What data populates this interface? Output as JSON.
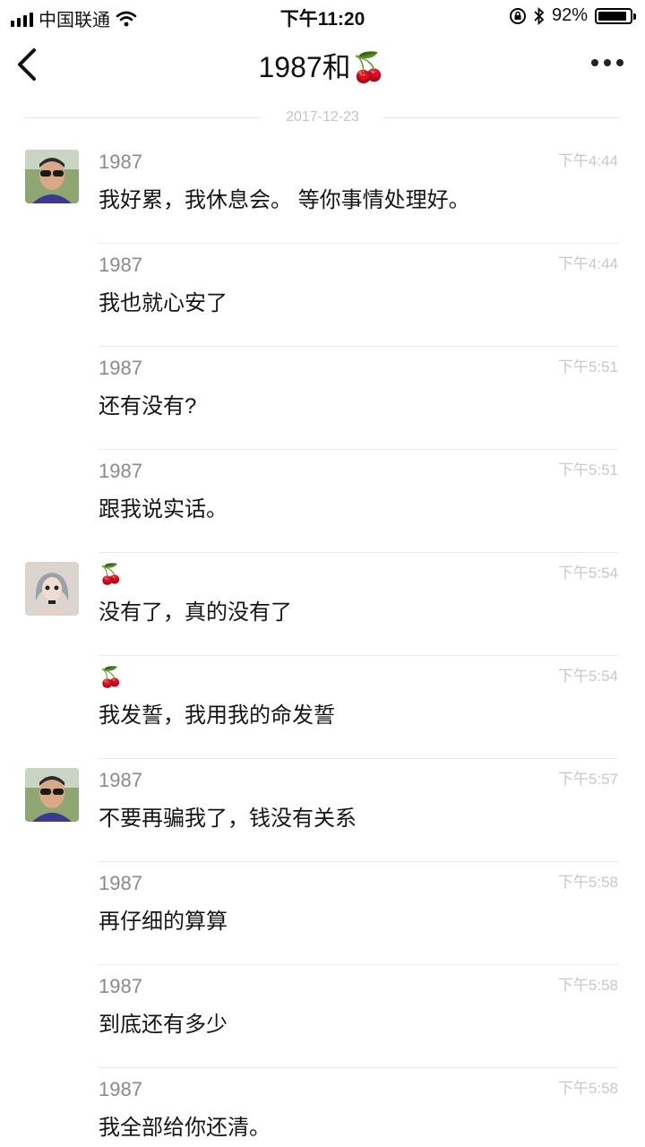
{
  "status_bar": {
    "carrier": "中国联通",
    "time": "下午11:20",
    "battery": "92%",
    "battery_level": 0.92
  },
  "nav": {
    "title": "1987和🍒"
  },
  "date_divider": "2017-12-23",
  "messages": [
    {
      "sender": "1987",
      "time": "下午4:44",
      "text": "我好累，我休息会。  等你事情处理好。"
    },
    {
      "sender": "1987",
      "time": "下午4:44",
      "text": "我也就心安了"
    },
    {
      "sender": "1987",
      "time": "下午5:51",
      "text": "还有没有?"
    },
    {
      "sender": "1987",
      "time": "下午5:51",
      "text": "跟我说实话。"
    },
    {
      "sender": "🍒",
      "time": "下午5:54",
      "text": "没有了，真的没有了"
    },
    {
      "sender": "🍒",
      "time": "下午5:54",
      "text": "我发誓，我用我的命发誓"
    },
    {
      "sender": "1987",
      "time": "下午5:57",
      "text": "不要再骗我了，钱没有关系"
    },
    {
      "sender": "1987",
      "time": "下午5:58",
      "text": "再仔细的算算"
    },
    {
      "sender": "1987",
      "time": "下午5:58",
      "text": "到底还有多少"
    },
    {
      "sender": "1987",
      "time": "下午5:58",
      "text": "我全部给你还清。"
    }
  ]
}
